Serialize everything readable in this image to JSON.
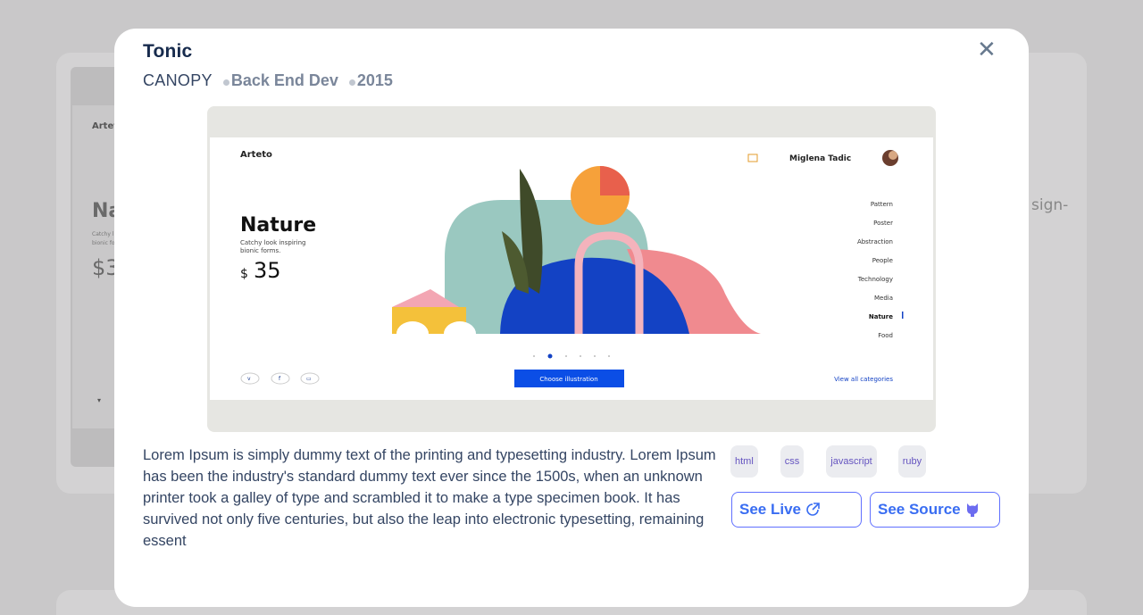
{
  "background": {
    "brand": "Arteto",
    "title": "Na",
    "subtitle": "Catchy l bionic fo",
    "price": "$3",
    "side_text": "sign-"
  },
  "modal": {
    "title": "Tonic",
    "client": "CANOPY",
    "role": "Back End Dev",
    "year": "2015",
    "close_label": "✕",
    "description": "Lorem Ipsum is simply dummy text of the printing and typesetting industry. Lorem Ipsum has been the industry's standard dummy text ever since the 1500s, when an unknown printer took a galley of type and scrambled it to make a type specimen book. It has survived not only five centuries, but also the leap into electronic typesetting, remaining essent",
    "tags": [
      "html",
      "css",
      "javascript",
      "ruby"
    ],
    "see_live_label": "See Live",
    "see_source_label": "See Source"
  },
  "screenshot": {
    "brand": "Arteto",
    "user_name": "Miglena Tadic",
    "title": "Nature",
    "subtitle_line1": "Catchy look inspiring",
    "subtitle_line2": "bionic forms.",
    "price_currency": "$",
    "price": "35",
    "categories": [
      "Pattern",
      "Poster",
      "Abstraction",
      "People",
      "Technology",
      "Media",
      "Nature",
      "Food"
    ],
    "cta_label": "Choose illustration",
    "view_all_label": "View all categories"
  },
  "colors": {
    "accent": "#396df2",
    "title": "#172b4d",
    "tag_bg": "#ebecf0",
    "cta": "#0b4ee6"
  }
}
